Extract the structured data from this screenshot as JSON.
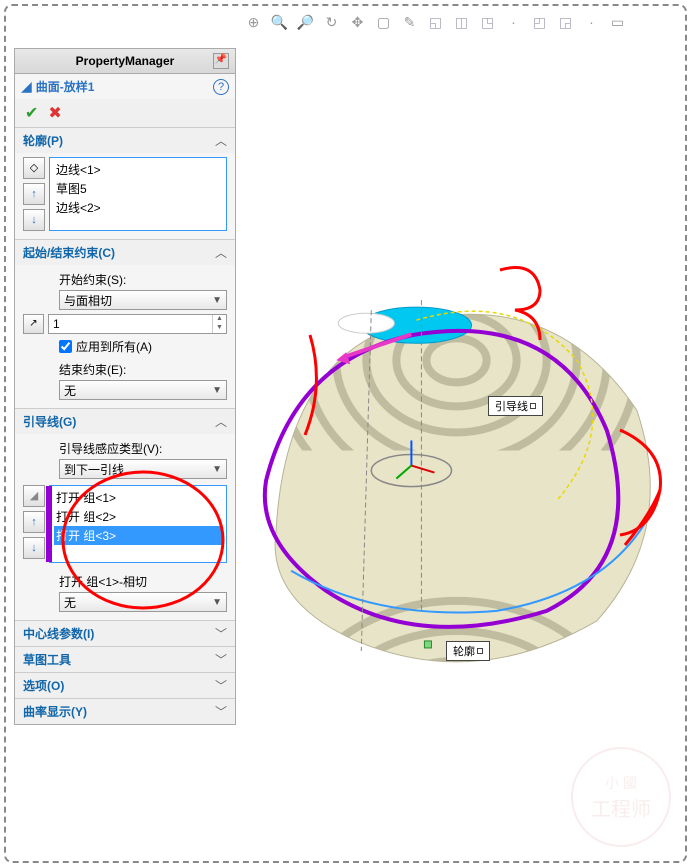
{
  "panel": {
    "title": "PropertyManager",
    "feature_name": "曲面-放样1",
    "help": "?"
  },
  "profiles": {
    "header": "轮廓(P)",
    "items": [
      "边线<1>",
      "草图5",
      "边线<2>"
    ]
  },
  "constraints": {
    "header": "起始/结束约束(C)",
    "start_label": "开始约束(S):",
    "start_value": "与面相切",
    "num_value": "1",
    "apply_all": "应用到所有(A)",
    "end_label": "结束约束(E):",
    "end_value": "无"
  },
  "guides": {
    "header": "引导线(G)",
    "influence_label": "引导线感应类型(V):",
    "influence_value": "到下一引线",
    "items": [
      "打开 组<1>",
      "打开 组<2>",
      "打开 组<3>"
    ],
    "selected_index": 2,
    "tangent_label": "打开 组<1>-相切",
    "tangent_value": "无"
  },
  "sections": {
    "centerline": "中心线参数(I)",
    "sketch_tools": "草图工具",
    "options": "选项(O)",
    "curvature": "曲率显示(Y)"
  },
  "viewport": {
    "label_guide": "引导线",
    "label_profile": "轮廓"
  },
  "watermark": {
    "line1": "小 國",
    "line2": "工程师"
  }
}
